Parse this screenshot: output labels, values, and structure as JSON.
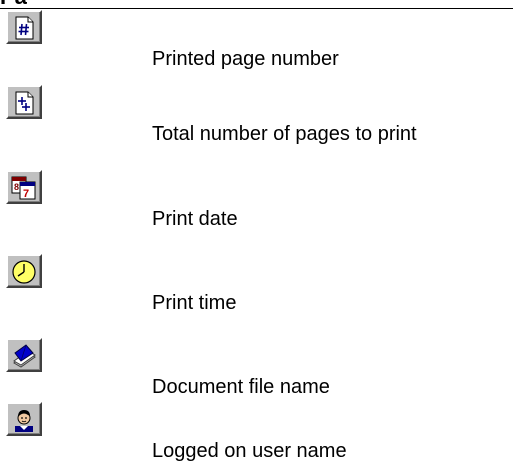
{
  "heading_fragment": "Pag",
  "items": [
    {
      "icon": "page-number-icon",
      "label": "Printed page number"
    },
    {
      "icon": "total-pages-icon",
      "label": "Total number of pages to print"
    },
    {
      "icon": "calendar-icon",
      "label": "Print date"
    },
    {
      "icon": "clock-icon",
      "label": "Print time"
    },
    {
      "icon": "book-icon",
      "label": "Document file name"
    },
    {
      "icon": "user-icon",
      "label": "Logged on user name"
    }
  ]
}
